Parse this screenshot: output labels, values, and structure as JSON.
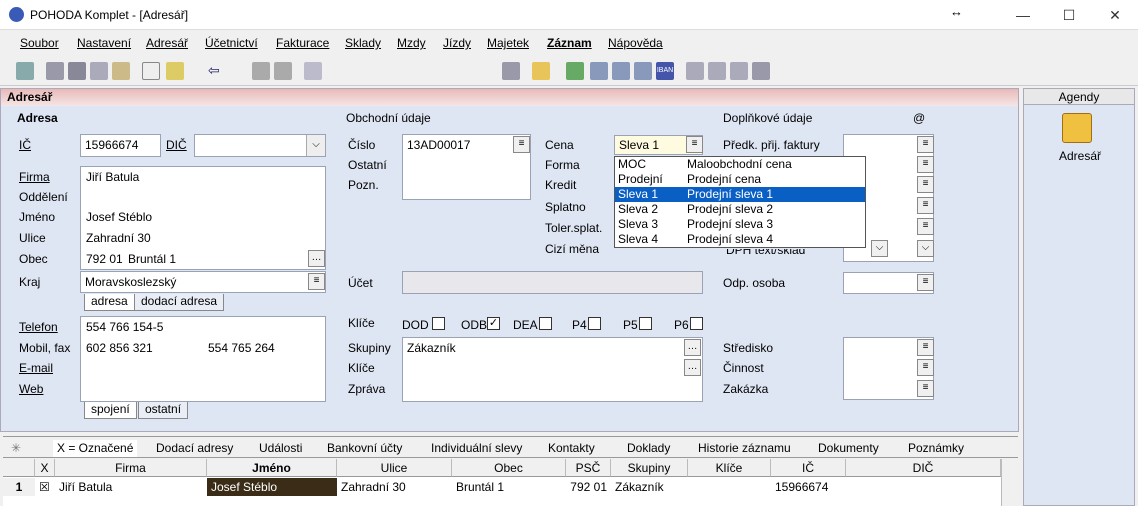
{
  "window": {
    "title": "POHODA Komplet - [Adresář]"
  },
  "menu": [
    "Soubor",
    "Nastavení",
    "Adresář",
    "Účetnictví",
    "Fakturace",
    "Sklady",
    "Mzdy",
    "Jízdy",
    "Majetek",
    "Záznam",
    "Nápověda"
  ],
  "section_title": "Adresář",
  "adresa": {
    "header": "Adresa",
    "ic_label": "IČ",
    "ic_value": "15966674",
    "dic_label": "DIČ",
    "dic_value": "",
    "firma_label": "Firma",
    "firma_value": "Jiří Batula",
    "oddeleni_label": "Oddělení",
    "oddeleni_value": "",
    "jmeno_label": "Jméno",
    "jmeno_value": "Josef Stéblo",
    "ulice_label": "Ulice",
    "ulice_value": "Zahradní 30",
    "obec_label": "Obec",
    "psc_value": "792 01",
    "obec_value": "Bruntál 1",
    "kraj_label": "Kraj",
    "kraj_value": "Moravskoslezský",
    "tab_adresa": "adresa",
    "tab_dodaci": "dodací adresa",
    "telefon_label": "Telefon",
    "telefon_value": "554 766 154-5",
    "mobil_label": "Mobil, fax",
    "mobil_value": "602 856 321",
    "fax_value": "554 765 264",
    "email_label": "E-mail",
    "web_label": "Web",
    "tab_spojeni": "spojení",
    "tab_ostatni": "ostatní"
  },
  "obchodni": {
    "header": "Obchodní údaje",
    "cislo_label": "Číslo",
    "cislo_value": "13AD00017",
    "ostatni_label": "Ostatní",
    "pozn_label": "Pozn.",
    "cena_label": "Cena",
    "cena_value": "Sleva 1",
    "forma_label": "Forma",
    "kredit_label": "Kredit",
    "splatno_label": "Splatno",
    "toler_label": "Toler.splat.",
    "cizi_label": "Cizí měna",
    "ucet_label": "Účet",
    "klice_label": "Klíče",
    "checks": [
      {
        "label": "DOD",
        "checked": false
      },
      {
        "label": "ODB",
        "checked": true
      },
      {
        "label": "DEA",
        "checked": false
      },
      {
        "label": "P4",
        "checked": false
      },
      {
        "label": "P5",
        "checked": false
      },
      {
        "label": "P6",
        "checked": false
      }
    ],
    "skupiny_label": "Skupiny",
    "skupiny_value": "Zákazník",
    "klice2_label": "Klíče",
    "zprava_label": "Zpráva"
  },
  "price_dropdown": [
    {
      "code": "MOC",
      "name": "Maloobchodní cena",
      "selected": false
    },
    {
      "code": "Prodejní",
      "name": "Prodejní cena",
      "selected": false
    },
    {
      "code": "Sleva 1",
      "name": "Prodejní sleva 1",
      "selected": true
    },
    {
      "code": "Sleva 2",
      "name": "Prodejní sleva 2",
      "selected": false
    },
    {
      "code": "Sleva 3",
      "name": "Prodejní sleva 3",
      "selected": false
    },
    {
      "code": "Sleva 4",
      "name": "Prodejní sleva 4",
      "selected": false
    }
  ],
  "doplnkove": {
    "header": "Doplňkové údaje",
    "at": "@",
    "predk_label": "Předk. přij. faktury",
    "dph_label": "DPH text/sklad",
    "odp_label": "Odp. osoba",
    "stredisko_label": "Středisko",
    "cinnost_label": "Činnost",
    "zakazka_label": "Zakázka"
  },
  "agendy": {
    "header": "Agendy",
    "item": "Adresář"
  },
  "bottom_tabs": [
    "X = Označené",
    "Dodací adresy",
    "Události",
    "Bankovní účty",
    "Individuální slevy",
    "Kontakty",
    "Doklady",
    "Historie záznamu",
    "Dokumenty",
    "Poznámky"
  ],
  "grid": {
    "columns": [
      "X",
      "Firma",
      "Jméno",
      "Ulice",
      "Obec",
      "PSČ",
      "Skupiny",
      "Klíče",
      "IČ",
      "DIČ"
    ],
    "rows": [
      {
        "num": "1",
        "x": "☒",
        "firma": "Jiří Batula",
        "jmeno": "Josef Stéblo",
        "ulice": "Zahradní 30",
        "obec": "Bruntál 1",
        "psc": "792 01",
        "skupiny": "Zákazník",
        "klice": "",
        "ic": "15966674",
        "dic": ""
      }
    ]
  }
}
